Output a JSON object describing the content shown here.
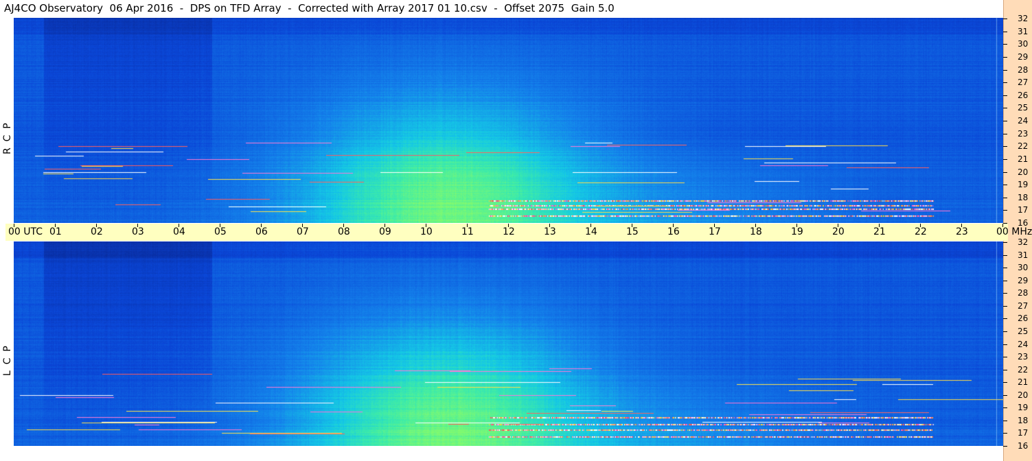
{
  "title": "AJ4CO Observatory  06 Apr 2016  -  DPS on TFD Array  -  Corrected with Array 2017 01 10.csv  -  Offset 2075  Gain 5.0",
  "polarizations": {
    "top": "R  C  P",
    "bottom": "L  C  P"
  },
  "time_axis": {
    "labels": [
      "00 UTC",
      "01",
      "02",
      "03",
      "04",
      "05",
      "06",
      "07",
      "08",
      "09",
      "10",
      "11",
      "12",
      "13",
      "14",
      "15",
      "16",
      "17",
      "18",
      "19",
      "20",
      "21",
      "22",
      "23",
      "00 MHz"
    ]
  },
  "freq_axis": {
    "labels": [
      "32",
      "31",
      "30",
      "29",
      "28",
      "27",
      "26",
      "25",
      "24",
      "23",
      "22",
      "21",
      "20",
      "19",
      "18",
      "17",
      "16"
    ]
  },
  "colors": {
    "time_band": "#ffffc0",
    "right_strip": "#ffdcb8",
    "low_intensity": "#0a3fc8",
    "high_intensity": "#5af08c"
  },
  "chart_data": {
    "type": "heatmap",
    "title": "AJ4CO Observatory  06 Apr 2016  -  DPS on TFD Array  -  Corrected with Array 2017 01 10.csv  -  Offset 2075  Gain 5.0",
    "x_range_utc_hours": [
      0,
      24
    ],
    "y_range_mhz": [
      16,
      32
    ],
    "panels": [
      "RCP",
      "LCP"
    ],
    "colormap": "blue-cyan-green with red/yellow/white interference"
  }
}
